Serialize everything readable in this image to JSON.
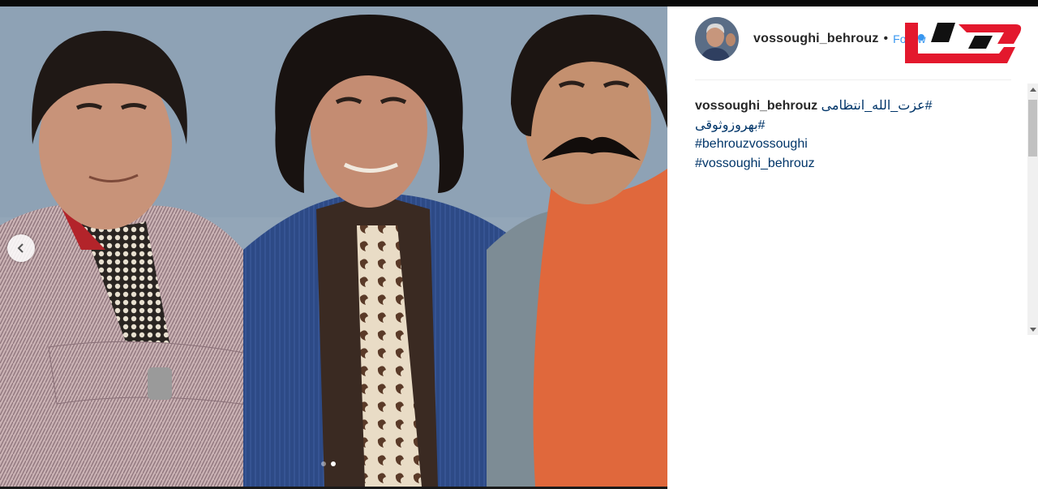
{
  "post": {
    "username": "vossoughi_behrouz",
    "separator": "•",
    "follow_label": "Follow"
  },
  "caption": {
    "username": "vossoughi_behrouz",
    "hashtags": [
      "#عزت_الله_انتظامی",
      "#بهروزوثوقی",
      "#behrouzvossoughi",
      "#vossoughi_behrouz"
    ]
  },
  "carousel": {
    "slide_count": 2,
    "active_slide": 2
  },
  "colors": {
    "hashtag": "#003569",
    "username": "#262626",
    "follow": "#3897f0",
    "logo_red": "#e3182d"
  },
  "icons": {
    "prev": "chevron-left-icon",
    "avatar": "profile-photo",
    "logo": "news-site-logo"
  }
}
